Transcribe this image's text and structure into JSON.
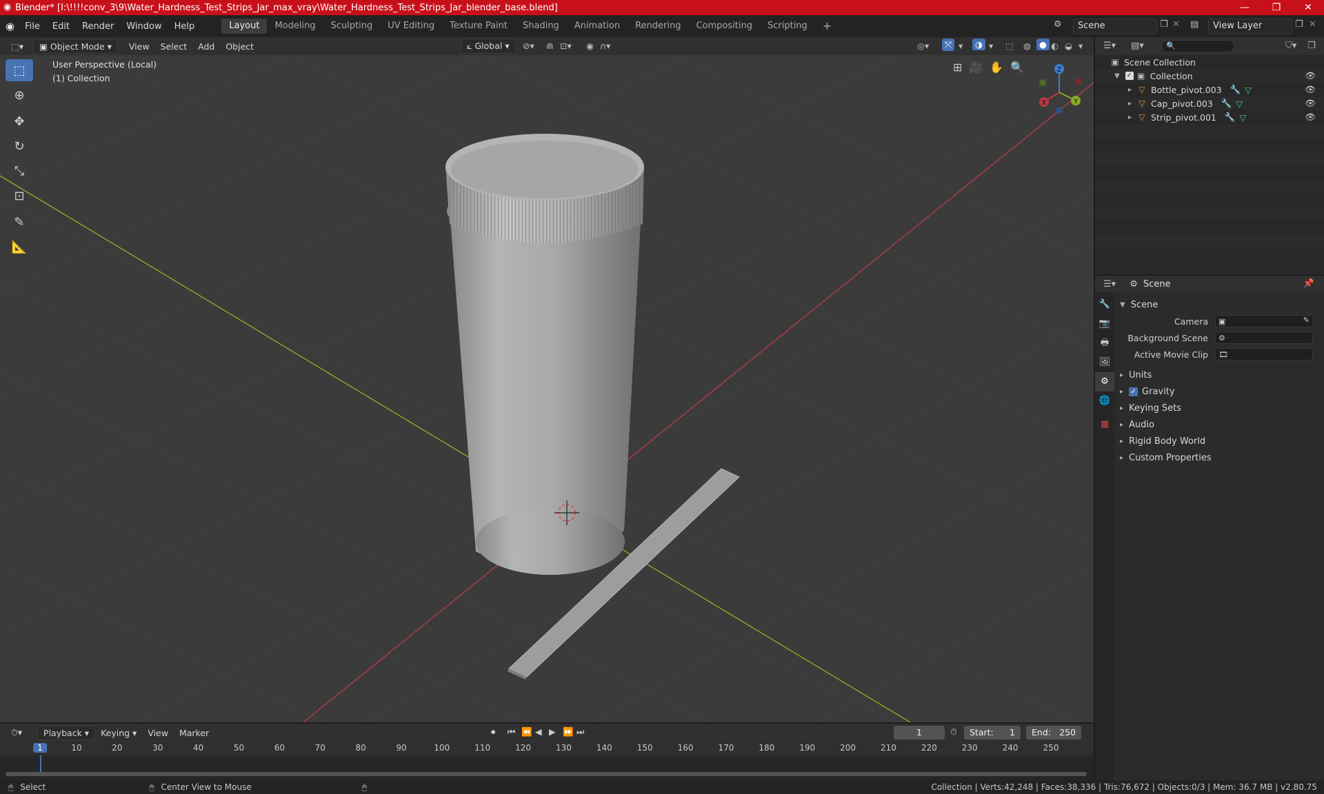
{
  "window": {
    "title": "Blender* [I:\\!!!!conv_3\\9\\Water_Hardness_Test_Strips_Jar_max_vray\\Water_Hardness_Test_Strips_Jar_blender_base.blend]"
  },
  "menu": [
    "File",
    "Edit",
    "Render",
    "Window",
    "Help"
  ],
  "workspaces": [
    "Layout",
    "Modeling",
    "Sculpting",
    "UV Editing",
    "Texture Paint",
    "Shading",
    "Animation",
    "Rendering",
    "Compositing",
    "Scripting"
  ],
  "active_workspace": "Layout",
  "scene_field": "Scene",
  "view_layer_field": "View Layer",
  "viewport_header": {
    "mode": "Object Mode",
    "menus": [
      "View",
      "Select",
      "Add",
      "Object"
    ],
    "transform_orientation": "Global"
  },
  "viewport": {
    "perspective_label": "User Perspective (Local)",
    "collection_label": "(1) Collection",
    "gizmo_axes": {
      "x": "X",
      "y": "Y",
      "z": "Z"
    }
  },
  "outliner": {
    "root": "Scene Collection",
    "collection": "Collection",
    "items": [
      "Bottle_pivot.003",
      "Cap_pivot.003",
      "Strip_pivot.001"
    ]
  },
  "properties": {
    "header": "Scene",
    "panel_title": "Scene",
    "fields": [
      "Camera",
      "Background Scene",
      "Active Movie Clip"
    ],
    "sections": [
      "Units",
      "Gravity",
      "Keying Sets",
      "Audio",
      "Rigid Body World",
      "Custom Properties"
    ]
  },
  "timeline": {
    "menus": [
      "Playback",
      "Keying",
      "View",
      "Marker"
    ],
    "current_frame": "1",
    "start_label": "Start:",
    "start_value": "1",
    "end_label": "End:",
    "end_value": "250",
    "ruler": [
      "1",
      "10",
      "20",
      "30",
      "40",
      "50",
      "60",
      "70",
      "80",
      "90",
      "100",
      "110",
      "120",
      "130",
      "140",
      "150",
      "160",
      "170",
      "180",
      "190",
      "200",
      "210",
      "220",
      "230",
      "240",
      "250"
    ]
  },
  "statusbar": {
    "left1": "Select",
    "left2": "Center View to Mouse",
    "stats": "Collection | Verts:42,248 | Faces:38,336 | Tris:76,672 | Objects:0/3 | Mem: 36.7 MB | v2.80.75"
  },
  "colors": {
    "titlebar": "#c8101a",
    "accent": "#4772b3",
    "viewport_bg": "#3b3b3b",
    "axis_x": "#b93a45",
    "axis_y": "#8aab24",
    "axis_z": "#3d7fd0"
  }
}
